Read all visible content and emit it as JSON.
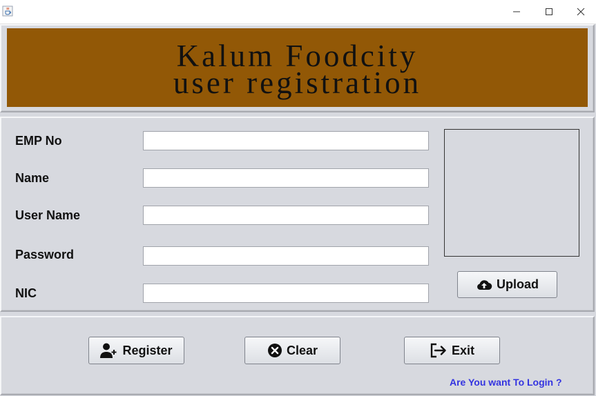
{
  "window": {
    "icon": "java-cup-icon",
    "controls": [
      "minimize-icon",
      "maximize-icon",
      "close-icon"
    ]
  },
  "banner": {
    "line1": "Kalum Foodcity",
    "line2": "user registration",
    "background_color": "#925806"
  },
  "form": {
    "emp_no_label": "EMP No",
    "name_label": "Name",
    "user_name_label": "User Name",
    "password_label": "Password",
    "nic_label": "NIC",
    "emp_no_value": "",
    "name_value": "",
    "user_name_value": "",
    "password_value": "",
    "nic_value": ""
  },
  "photo": {
    "upload_label": "Upload",
    "upload_icon": "cloud-upload-icon"
  },
  "actions": {
    "register_label": "Register",
    "register_icon": "add-user-icon",
    "clear_label": "Clear",
    "clear_icon": "close-circle-icon",
    "exit_label": "Exit",
    "exit_icon": "sign-out-icon",
    "login_link": "Are You want To Login ?",
    "link_color": "#3333e0"
  }
}
